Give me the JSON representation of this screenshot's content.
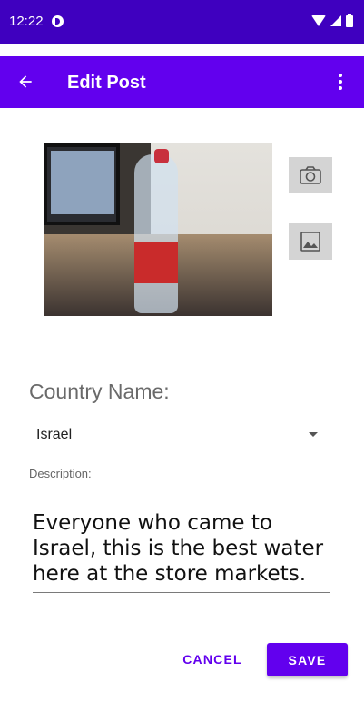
{
  "status_bar": {
    "time": "12:22",
    "icons": [
      "app-icon",
      "wifi-icon",
      "cellular-icon",
      "battery-icon"
    ]
  },
  "app_bar": {
    "title": "Edit Post",
    "back_icon": "arrow-left-icon",
    "overflow_icon": "more-vert-icon"
  },
  "media": {
    "photo_subject": "image-photo",
    "camera_icon": "camera-icon",
    "gallery_icon": "image-icon"
  },
  "form": {
    "country_label": "Country Name:",
    "country_value": "Israel",
    "description_label": "Description:",
    "description_value": "Everyone who came to Israel, this is the best water here at the store markets."
  },
  "actions": {
    "cancel_label": "CANCEL",
    "save_label": "SAVE"
  },
  "colors": {
    "status_bar": "#3f00bf",
    "app_bar": "#6200ee",
    "accent": "#6200ee"
  }
}
